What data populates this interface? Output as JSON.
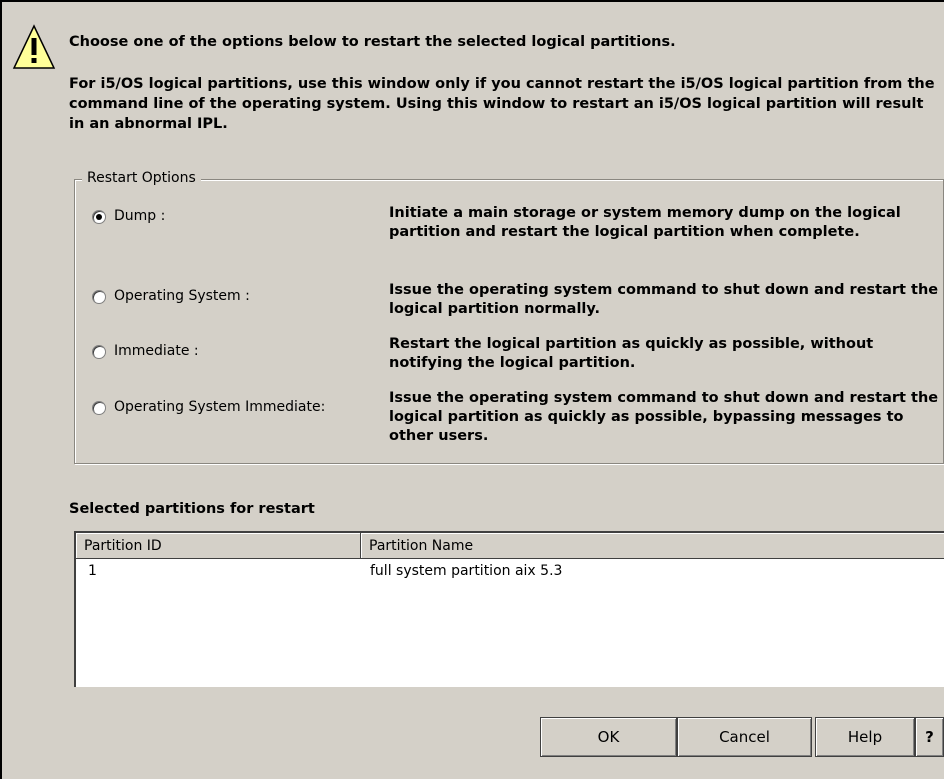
{
  "message": {
    "line1": "Choose one of the options below to restart the selected logical partitions.",
    "line2": "For i5/OS logical partitions, use this window only if you cannot restart the i5/OS logical partition from the command line of the operating system. Using this window to restart an i5/OS logical partition will result in an abnormal IPL."
  },
  "restart_options": {
    "group_title": "Restart Options",
    "selected": "Dump :",
    "options": [
      {
        "label": "Dump :",
        "description": "Initiate a main storage or system memory dump on the logical partition and restart the logical partition when complete."
      },
      {
        "label": "Operating System :",
        "description": "Issue the operating system command to shut down and restart the logical partition normally."
      },
      {
        "label": "Immediate :",
        "description": "Restart the logical partition as quickly as possible, without notifying the logical partition."
      },
      {
        "label": "Operating System Immediate:",
        "description": "Issue the operating system command to shut down and restart the logical partition as quickly as possible, bypassing messages to other users."
      }
    ]
  },
  "partitions": {
    "title": "Selected partitions for restart",
    "columns": [
      "Partition ID",
      "Partition Name"
    ],
    "rows": [
      {
        "id": "1",
        "name": "full system partition aix 5.3"
      }
    ]
  },
  "buttons": {
    "ok": "OK",
    "cancel": "Cancel",
    "help": "Help",
    "context_help": "?"
  },
  "icons": {
    "warning": "warning-triangle-icon"
  }
}
